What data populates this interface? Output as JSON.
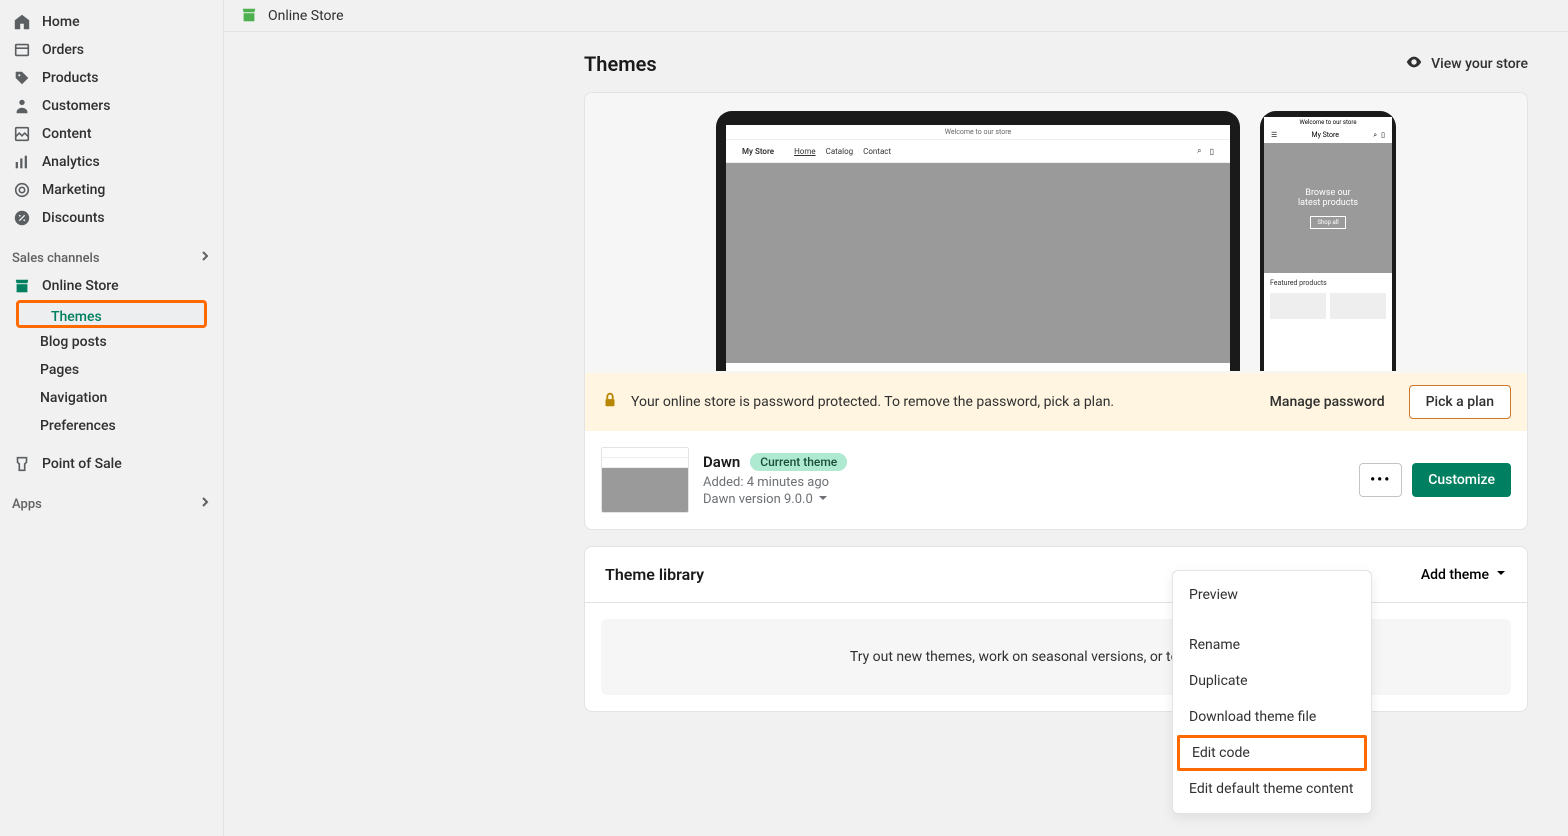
{
  "topbar": {
    "title": "Online Store"
  },
  "sidebar": {
    "items": [
      {
        "label": "Home"
      },
      {
        "label": "Orders"
      },
      {
        "label": "Products"
      },
      {
        "label": "Customers"
      },
      {
        "label": "Content"
      },
      {
        "label": "Analytics"
      },
      {
        "label": "Marketing"
      },
      {
        "label": "Discounts"
      }
    ],
    "sales_header": "Sales channels",
    "online_store": "Online Store",
    "subitems": [
      {
        "label": "Themes"
      },
      {
        "label": "Blog posts"
      },
      {
        "label": "Pages"
      },
      {
        "label": "Navigation"
      },
      {
        "label": "Preferences"
      }
    ],
    "pos": "Point of Sale",
    "apps_header": "Apps"
  },
  "page": {
    "title": "Themes",
    "view_store": "View your store"
  },
  "preview": {
    "welcome": "Welcome to our store",
    "store_name": "My Store",
    "nav_home": "Home",
    "nav_catalog": "Catalog",
    "nav_contact": "Contact",
    "mobile_hero_line1": "Browse our",
    "mobile_hero_line2": "latest products",
    "mobile_hero_btn": "Shop all",
    "featured": "Featured products"
  },
  "banner": {
    "text": "Your online store is password protected. To remove the password, pick a plan.",
    "manage": "Manage password",
    "pick": "Pick a plan"
  },
  "theme": {
    "name": "Dawn",
    "badge": "Current theme",
    "added": "Added: 4 minutes ago",
    "version": "Dawn version 9.0.0",
    "customize": "Customize"
  },
  "menu": {
    "items": [
      "Preview",
      "Rename",
      "Duplicate",
      "Download theme file",
      "Edit code",
      "Edit default theme content"
    ]
  },
  "library": {
    "title": "Theme library",
    "add": "Add theme",
    "empty": "Try out new themes, work on seasonal versions, or test changes to"
  }
}
